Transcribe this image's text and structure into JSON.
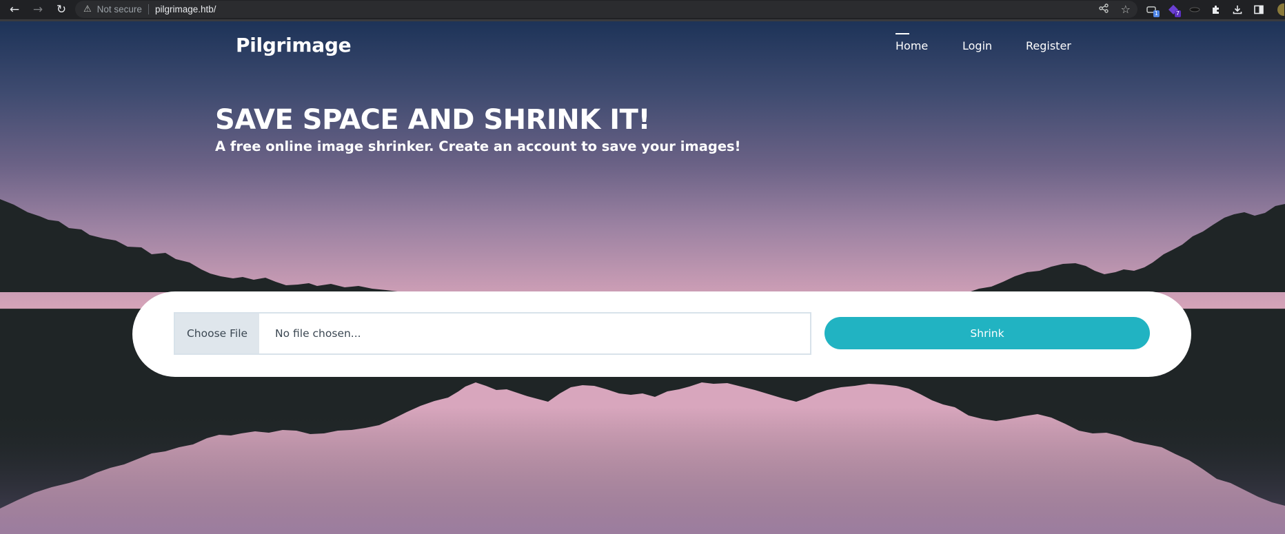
{
  "browser": {
    "security_label": "Not secure",
    "url": "pilgrimage.htb/",
    "ext_badges": [
      "1",
      "7"
    ]
  },
  "nav": {
    "brand": "Pilgrimage",
    "links": [
      {
        "label": "Home",
        "active": true
      },
      {
        "label": "Login",
        "active": false
      },
      {
        "label": "Register",
        "active": false
      }
    ]
  },
  "hero": {
    "title": "SAVE SPACE AND SHRINK IT!",
    "subtitle": "A free online image shrinker. Create an account to save your images!"
  },
  "upload": {
    "choose_label": "Choose File",
    "file_status": "No file chosen...",
    "submit_label": "Shrink"
  },
  "colors": {
    "accent": "#21b3c2",
    "sky_top": "#1d3358",
    "sky_bottom": "#d6a4b9",
    "land": "#1f2526"
  }
}
